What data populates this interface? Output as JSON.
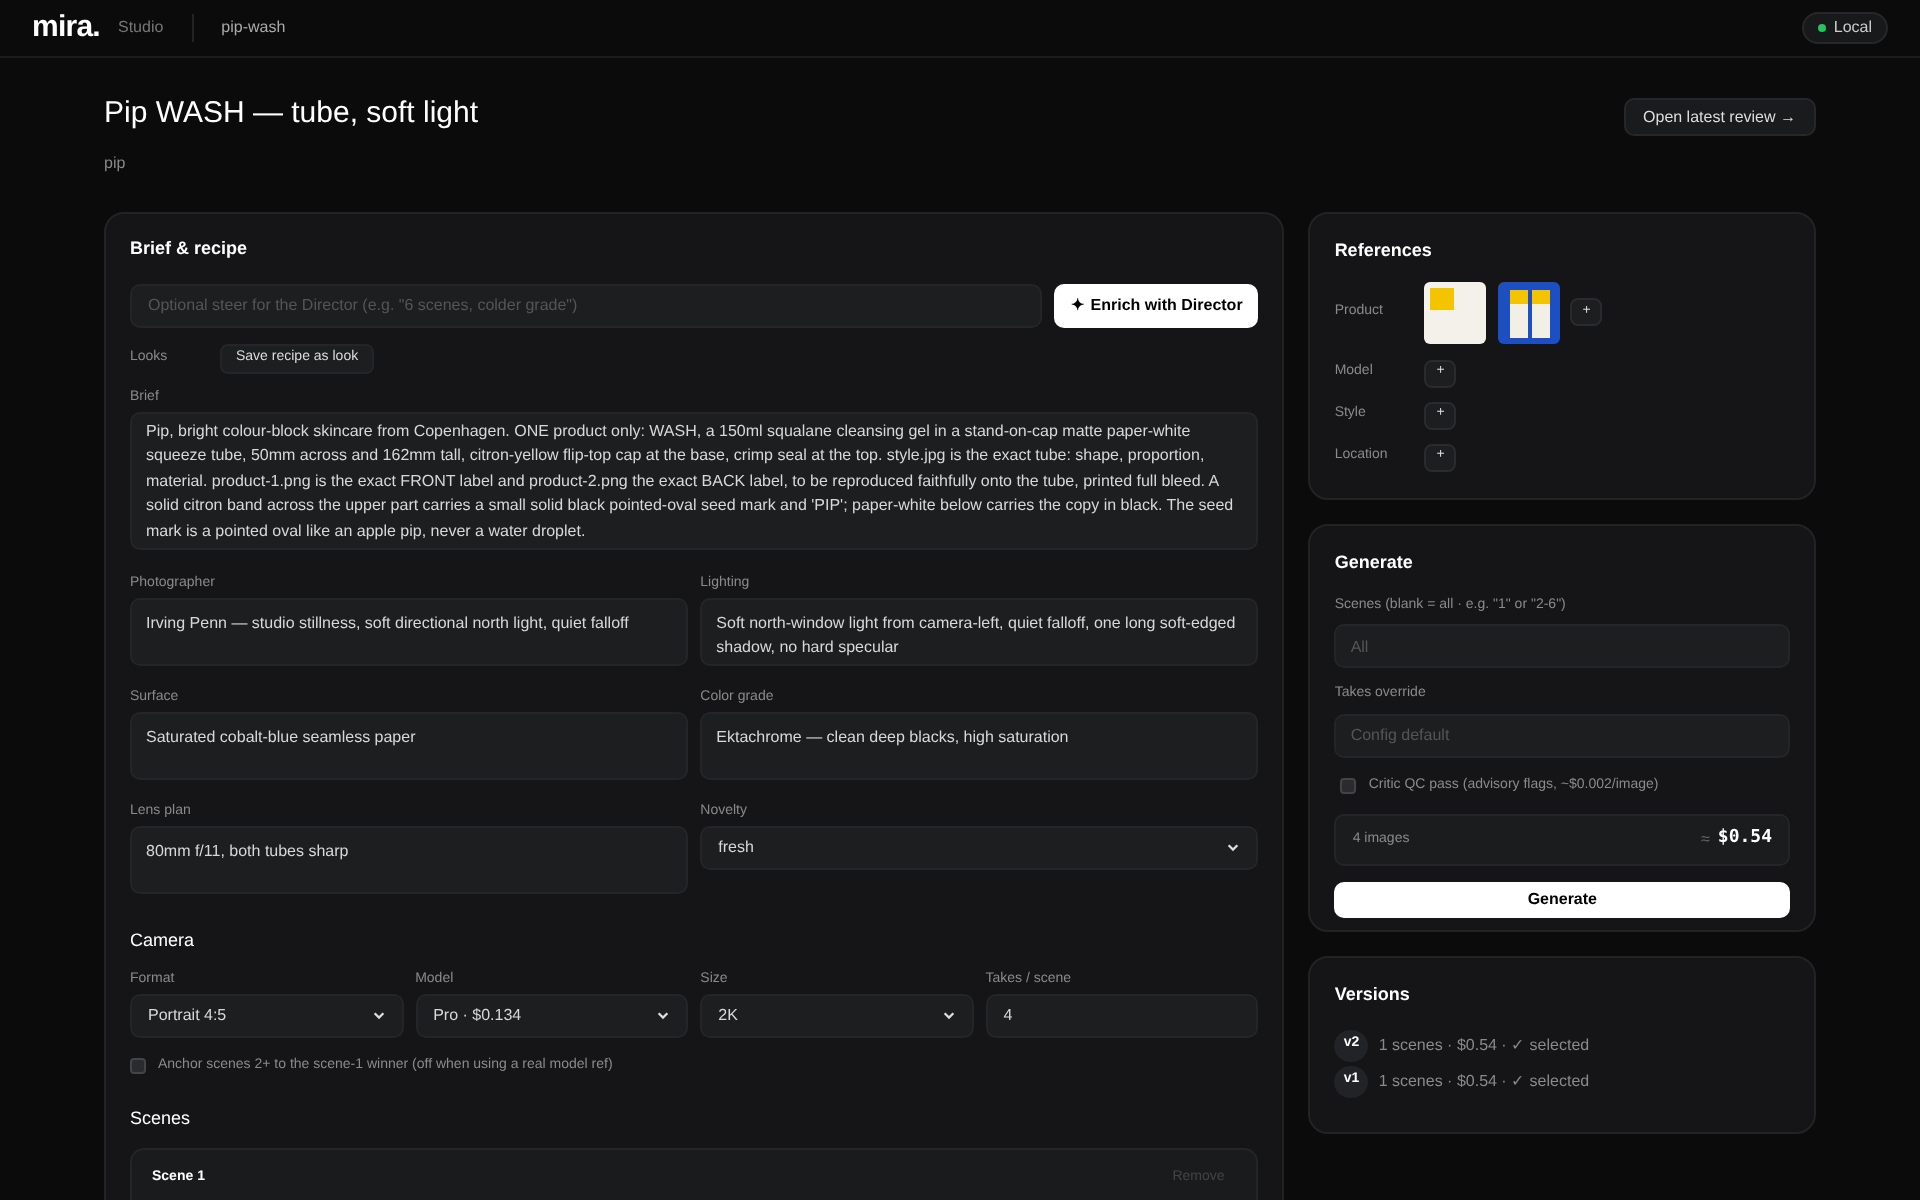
{
  "header": {
    "logo": "mira.",
    "app": "Studio",
    "project": "pip-wash",
    "status": {
      "label": "Local",
      "color": "#22c55e"
    }
  },
  "page": {
    "title": "Pip WASH — tube, soft light",
    "subtitle": "pip",
    "review_button": "Open latest review →"
  },
  "brief_recipe": {
    "title": "Brief & recipe",
    "steer_placeholder": "Optional steer for the Director (e.g. \"6 scenes, colder grade\")",
    "enrich_icon": "✦",
    "enrich_button": "Enrich with Director",
    "looks_label": "Looks",
    "save_look_button": "Save recipe as look",
    "brief_label": "Brief",
    "brief": "Pip, bright colour-block skincare from Copenhagen. ONE product only: WASH, a 150ml squalane cleansing gel in a stand-on-cap matte paper-white squeeze tube, 50mm across and 162mm tall, citron-yellow flip-top cap at the base, crimp seal at the top. style.jpg is the exact tube: shape, proportion, material. product-1.png is the exact FRONT label and product-2.png the exact BACK label, to be reproduced faithfully onto the tube, printed full bleed. A solid citron band across the upper part carries a small solid black pointed-oval seed mark and 'PIP'; paper-white below carries the copy in black. The seed mark is a pointed oval like an apple pip, never a water droplet.",
    "fields": [
      {
        "label": "Photographer",
        "kind": "textarea",
        "value": "Irving Penn — studio stillness, soft directional north light, quiet falloff"
      },
      {
        "label": "Lighting",
        "kind": "textarea",
        "value": "Soft north-window light from camera-left, quiet falloff, one long soft-edged shadow, no hard specular"
      },
      {
        "label": "Surface",
        "kind": "textarea",
        "value": "Saturated cobalt-blue seamless paper"
      },
      {
        "label": "Color grade",
        "kind": "textarea",
        "value": "Ektachrome — clean deep blacks, high saturation"
      },
      {
        "label": "Lens plan",
        "kind": "textarea",
        "value": "80mm f/11, both tubes sharp"
      },
      {
        "label": "Novelty",
        "kind": "select",
        "value": "fresh"
      }
    ]
  },
  "camera": {
    "title": "Camera",
    "fields": [
      {
        "label": "Format",
        "kind": "select",
        "value": "Portrait 4:5"
      },
      {
        "label": "Model",
        "kind": "select",
        "value": "Pro · $0.134"
      },
      {
        "label": "Size",
        "kind": "select",
        "value": "2K"
      },
      {
        "label": "Takes / scene",
        "kind": "input",
        "value": "4"
      }
    ],
    "anchor": {
      "label": "Anchor scenes 2+ to the scene-1 winner (off when using a real model ref)",
      "checked": false
    }
  },
  "scenes": {
    "title": "Scenes",
    "items": [
      {
        "title": "Scene 1",
        "remove": "Remove"
      }
    ]
  },
  "references": {
    "title": "References",
    "rows": [
      {
        "label": "Product",
        "images": [
          {
            "kind": "label_sheet"
          },
          {
            "kind": "tubes"
          }
        ],
        "add": "+"
      },
      {
        "label": "Model",
        "add": "+"
      },
      {
        "label": "Style",
        "add": "+"
      },
      {
        "label": "Location",
        "add": "+"
      }
    ]
  },
  "generate": {
    "title": "Generate",
    "scenes_label": "Scenes (blank = all · e.g. \"1\" or \"2-6\")",
    "scenes_placeholder": "All",
    "takes_label": "Takes override",
    "takes_placeholder": "Config default",
    "critic": {
      "label": "Critic QC pass (advisory flags, ~$0.002/image)",
      "checked": false
    },
    "estimate": {
      "count": "4 images",
      "approx": "≈",
      "price": "$0.54"
    },
    "button": "Generate"
  },
  "versions": {
    "title": "Versions",
    "items": [
      {
        "badge": "v2",
        "summary": "1 scenes · $0.54 · ✓ selected"
      },
      {
        "badge": "v1",
        "summary": "1 scenes · $0.54 · ✓ selected"
      }
    ]
  }
}
